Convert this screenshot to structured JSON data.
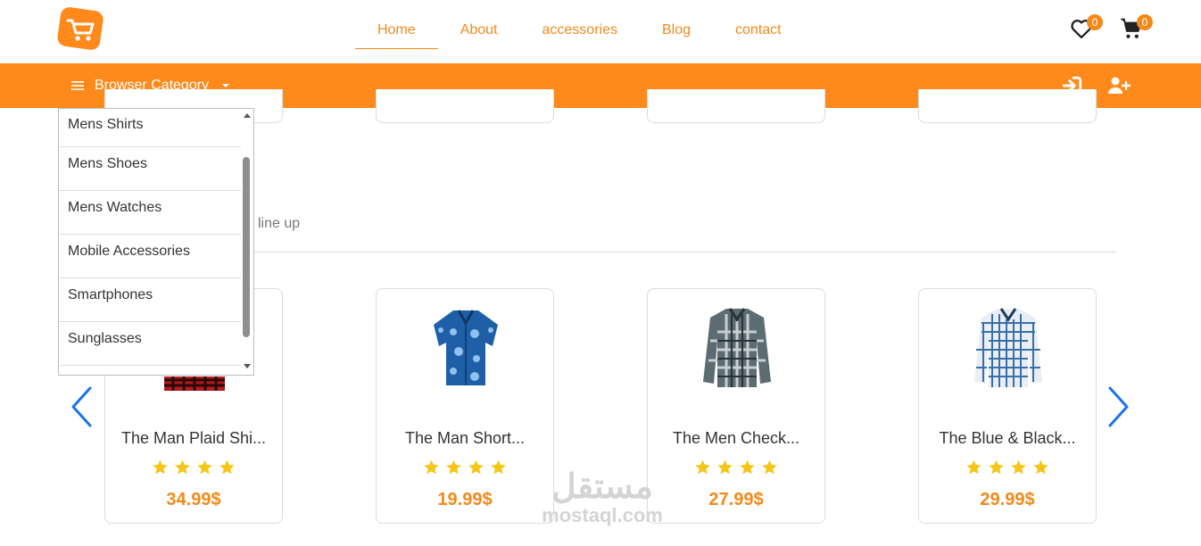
{
  "nav": {
    "items": [
      {
        "label": "Home",
        "active": true
      },
      {
        "label": "About"
      },
      {
        "label": "accessories"
      },
      {
        "label": "Blog"
      },
      {
        "label": "contact"
      }
    ],
    "wishlist_count": "0",
    "cart_count": "0"
  },
  "category_bar": {
    "label": "Browser Category",
    "login_icon": "sign-in-icon",
    "register_icon": "user-plus-icon"
  },
  "dropdown": {
    "items": [
      "Mens Shirts",
      "Mens Shoes",
      "Mens Watches",
      "Mobile Accessories",
      "Smartphones",
      "Sunglasses"
    ]
  },
  "section": {
    "subtitle": "line up"
  },
  "products": [
    {
      "title": "The Man Plaid Shi...",
      "price": "34.99$",
      "rating": 4
    },
    {
      "title": "The Man Short...",
      "price": "19.99$",
      "rating": 4
    },
    {
      "title": "The Men Check...",
      "price": "27.99$",
      "rating": 4
    },
    {
      "title": "The Blue & Black...",
      "price": "29.99$",
      "rating": 4
    }
  ],
  "watermark": {
    "arabic": "مستقل",
    "latin": "mostaql.com"
  },
  "colors": {
    "accent": "#ff8a1b",
    "star": "#f5c518",
    "arrow": "#1a73e8"
  }
}
